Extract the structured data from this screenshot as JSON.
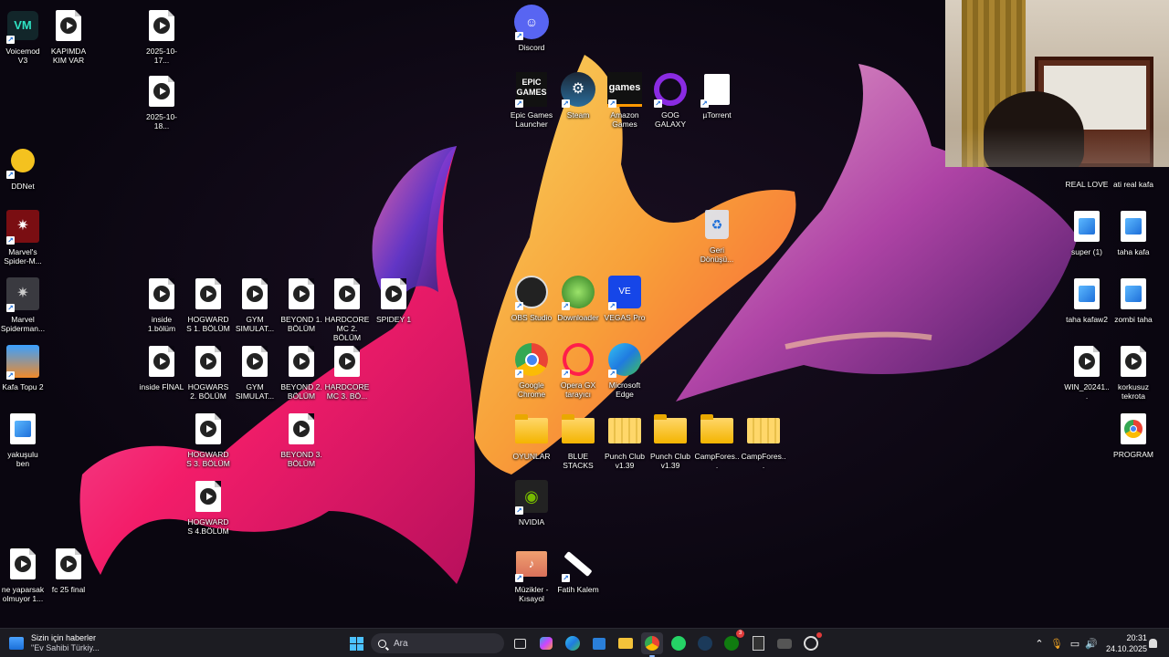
{
  "desktop": {
    "left_column": [
      {
        "name": "voicemod-icon",
        "label": "Voicemod V3"
      },
      {
        "name": "ddnet-icon",
        "label": "DDNet"
      },
      {
        "name": "spiderman-icon",
        "label": "Marvel's Spider-M..."
      },
      {
        "name": "spiderman2-icon",
        "label": "Marvel Spiderman..."
      },
      {
        "name": "kafatopu-icon",
        "label": "Kafa Topu 2"
      },
      {
        "name": "yakusulu-icon",
        "label": "yakuşulu ben"
      },
      {
        "name": "neyaparsak-icon",
        "label": "ne yaparsak olmuyor 1..."
      }
    ],
    "files": {
      "kapimda": "KAPIMDA KIM VAR",
      "date1": "2025-10-17...",
      "date2": "2025-10-18...",
      "inside1": "inside 1.bölüm",
      "hog1": "HOGWARDS 1. BÖLÜM",
      "gym1": "GYM SIMULAT...",
      "beyond1": "BEYOND 1. BÖLÜM",
      "hardcore2": "HARDCORE MC 2. BÖLÜM",
      "spidey": "SPIDEY 1",
      "insidefinal": "inside FİNAL",
      "hog2": "HOGWARS 2. BÖLÜM",
      "gym2": "GYM SIMULAT...",
      "beyond2": "BEYOND 2. BÖLÜM",
      "hardcore3": "HARDCORE MC 3. BÖ...",
      "hog3": "HOGWARDS 3. BÖLÜM",
      "beyond3": "BEYOND 3. BÖLÜM",
      "hog4": "HOGWARDS 4.BÖLÜM",
      "fc25": "fc 25 final"
    },
    "center": {
      "discord": "Discord",
      "epic": "Epic Games Launcher",
      "steam": "Steam",
      "amazon": "Amazon Games",
      "gog": "GOG GALAXY",
      "utorrent": "µTorrent",
      "recycle": "Geri Dönüşü...",
      "obs": "OBS Studio",
      "downloader": "Downloader",
      "vegas": "VEGAS Pro",
      "chrome": "Google Chrome",
      "opera": "Opera GX tarayıcı",
      "edge": "Microsoft Edge",
      "oyunlar": "OYUNLAR",
      "bluestacks": "BLUE STACKS",
      "punch1": "Punch Club v1.39",
      "punch2": "Punch Club v1.39",
      "camp1": "CampFores...",
      "camp2": "CampFores...",
      "nvidia": "NVIDIA",
      "muzikler": "Müzikler - Kısayol",
      "fatih": "Fatih Kalem"
    },
    "right_column": {
      "reallove": "REAL LOVE",
      "atirealkafa": "ati real kafa",
      "super": "super (1)",
      "tahakafa": "taha kafa",
      "tahakafaw2": "taha kafaw2",
      "zombitaha": "zombi taha",
      "win2024": "WIN_20241...",
      "korkusuz": "korkusuz tekrota",
      "program": "PROGRAM"
    }
  },
  "taskbar": {
    "news_title": "Sizin için haberler",
    "news_subtitle": "\"Ev Sahibi Türkiy...",
    "search_placeholder": "Ara",
    "xbox_badge": "3",
    "clock_time": "20:31",
    "clock_date": "24.10.2025"
  },
  "colors": {
    "taskbar_bg": "#1c1c22",
    "accent": "#8ab4f8"
  }
}
